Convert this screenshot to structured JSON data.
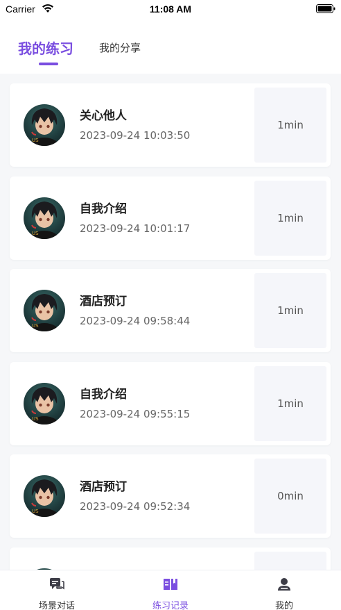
{
  "status_bar": {
    "carrier": "Carrier",
    "time": "11:08 AM"
  },
  "tabs": {
    "active": "我的练习",
    "inactive": "我的分享"
  },
  "records": [
    {
      "title": "关心他人",
      "time": "2023-09-24 10:03:50",
      "duration": "1min"
    },
    {
      "title": "自我介绍",
      "time": "2023-09-24 10:01:17",
      "duration": "1min"
    },
    {
      "title": "酒店预订",
      "time": "2023-09-24 09:58:44",
      "duration": "1min"
    },
    {
      "title": "自我介绍",
      "time": "2023-09-24 09:55:15",
      "duration": "1min"
    },
    {
      "title": "酒店预订",
      "time": "2023-09-24 09:52:34",
      "duration": "0min"
    }
  ],
  "tabbar": [
    {
      "label": "场景对话",
      "icon": "chat-icon"
    },
    {
      "label": "练习记录",
      "icon": "book-icon",
      "active": true
    },
    {
      "label": "我的",
      "icon": "person-icon"
    }
  ],
  "colors": {
    "accent": "#7a4ee0",
    "background": "#f6f7f9",
    "duration_bg": "#f5f6fa"
  }
}
